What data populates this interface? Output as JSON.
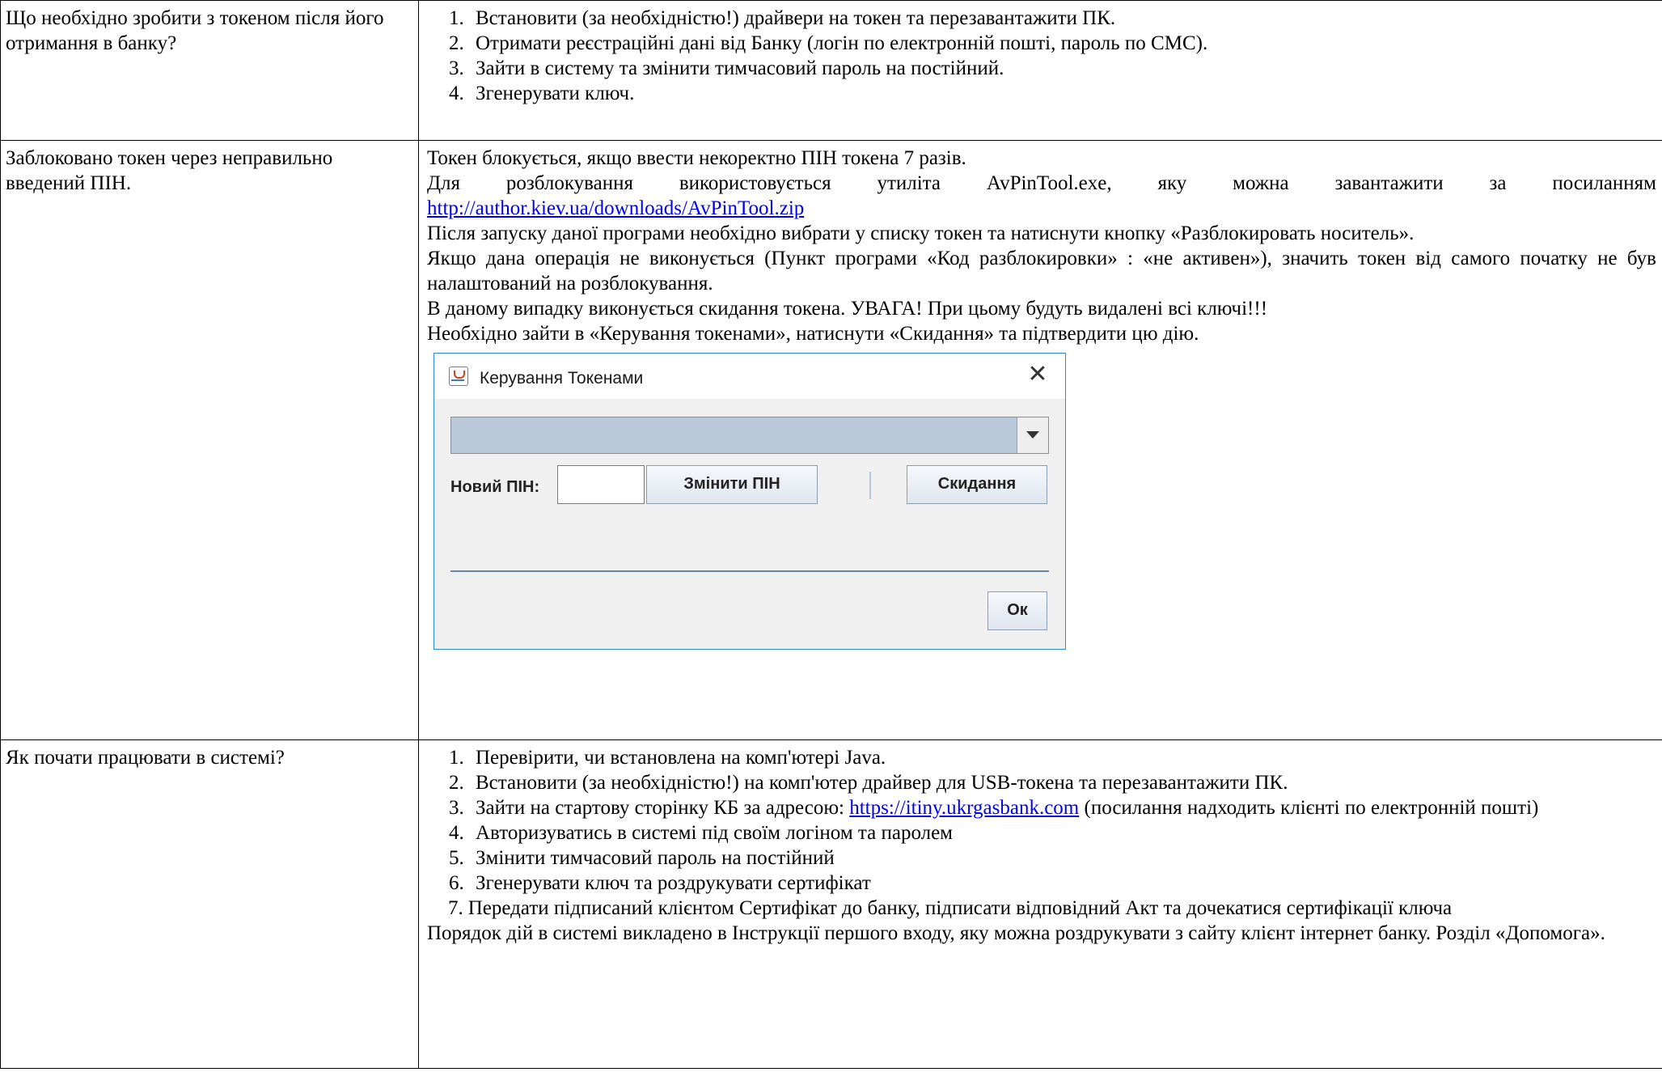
{
  "rows": [
    {
      "question": "Що необхідно зробити з токеном після його отримання в банку?",
      "steps": [
        "Встановити (за необхідністю!) драйвери на токен та перезавантажити ПК.",
        "Отримати реєстраційні дані від Банку (логін по електронній пошті, пароль по СМС).",
        "Зайти в систему та змінити тимчасовий пароль на постійний.",
        "Згенерувати ключ."
      ]
    },
    {
      "question": "Заблоковано токен через неправильно введений ПІН.",
      "p1": "Токен блокується, якщо ввести некоректно ПІН токена 7 разів.",
      "p2_prefix": "Для розблокування використовується утиліта AvPinTool.exe, яку можна завантажити за посиланням",
      "p2_link": "http://author.kiev.ua/downloads/AvPinTool.zip",
      "p3": "Після запуску даної програми необхідно вибрати у списку токен та натиснути кнопку «Разблокировать носитель».",
      "p4": "Якщо дана операція не виконується (Пункт програми «Код разблокировки» : «не активен»), значить токен від самого початку не був налаштований на розблокування.",
      "p5": "В даному випадку виконується скидання токена. УВАГА! При цьому будуть видалені всі ключі!!!",
      "p6": "Необхідно зайти в «Керування токенами», натиснути «Скидання» та підтвердити цю дію.",
      "dialog": {
        "title": "Керування Токенами",
        "pin_label": "Новий ПІН:",
        "pin_value": "",
        "change_button": "Змінити ПІН",
        "reset_button": "Скидання",
        "ok_button": "Ок"
      }
    },
    {
      "question": "Як почати працювати в системі?",
      "step1": "Перевірити, чи встановлена на комп'ютері Java.",
      "step2": "Встановити (за необхідністю!) на комп'ютер драйвер для USB-токена та перезавантажити ПК.",
      "step3_prefix": "Зайти на стартову сторінку КБ за адресою:",
      "step3_link": "https://itiny.ukrgasbank.com",
      "step3_suffix": "(посилання надходить клієнті по електронній пошті)",
      "step4": "Авторизуватись в системі під своїм логіном та паролем",
      "step5": "Змінити тимчасовий пароль на постійний",
      "step6": "Згенерувати ключ та роздрукувати сертифікат",
      "step7_num": "7.",
      "step7": "Передати підписаний клієнтом Сертифікат до банку, підписати відповідний Акт та дочекатися сертифікації ключа",
      "footer": "Порядок дій в системі викладено в Інструкції першого входу, яку можна роздрукувати з сайту клієнт інтернет банку. Розділ «Допомога»."
    }
  ]
}
